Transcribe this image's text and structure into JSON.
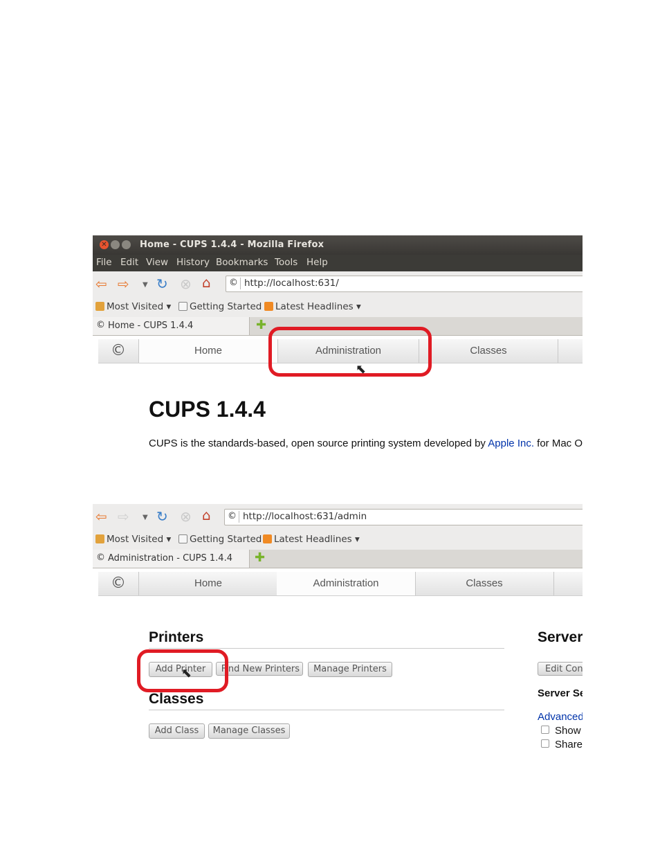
{
  "screenshot1": {
    "window_title": "Home - CUPS 1.4.4 - Mozilla Firefox",
    "menu": [
      "File",
      "Edit",
      "View",
      "History",
      "Bookmarks",
      "Tools",
      "Help"
    ],
    "url": "http://localhost:631/",
    "bookmarks": [
      "Most Visited ▾",
      "Getting Started",
      "Latest Headlines ▾"
    ],
    "tab_title": "Home - CUPS 1.4.4",
    "nav_tabs": [
      "Home",
      "Administration",
      "Classes"
    ],
    "heading": "CUPS 1.4.4",
    "description_pre": "CUPS is the standards-based, open source printing system developed by ",
    "description_link": "Apple Inc.",
    "description_post": " for Mac OS",
    "description_sup": "®"
  },
  "screenshot2": {
    "url": "http://localhost:631/admin",
    "bookmarks": [
      "Most Visited ▾",
      "Getting Started",
      "Latest Headlines ▾"
    ],
    "tab_title": "Administration - CUPS 1.4.4",
    "nav_tabs": [
      "Home",
      "Administration",
      "Classes"
    ],
    "printers_heading": "Printers",
    "printer_buttons": [
      "Add Printer",
      "Find New Printers",
      "Manage Printers"
    ],
    "classes_heading": "Classes",
    "class_buttons": [
      "Add Class",
      "Manage Classes"
    ],
    "server_heading": "Server",
    "server_button": "Edit Configuration File",
    "server_settings": "Server Settings:",
    "advanced": "Advanced",
    "checkboxes": [
      "Show printers shared by other systems",
      "Share printers connected to this system"
    ]
  },
  "colors": {
    "highlight": "#e01b24",
    "link": "#0033aa",
    "titlebar": "#3c3b37"
  },
  "icons": [
    "close-icon",
    "minimize-icon",
    "maximize-icon",
    "back-arrow-icon",
    "forward-arrow-icon",
    "reload-icon",
    "stop-icon",
    "home-icon",
    "cups-logo-icon",
    "new-tab-icon",
    "mouse-cursor-icon"
  ]
}
